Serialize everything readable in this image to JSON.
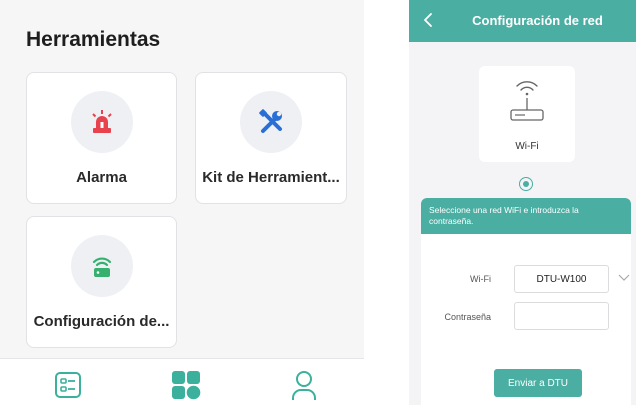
{
  "left": {
    "title": "Herramientas",
    "tools": [
      {
        "label": "Alarma",
        "icon": "alarm-light-icon",
        "color": "#e8424f"
      },
      {
        "label": "Kit de Herramient...",
        "icon": "tools-icon",
        "color": "#2a6fd6"
      },
      {
        "label": "Configuración de...",
        "icon": "router-wifi-icon",
        "color": "#35b06e"
      }
    ],
    "bottom_nav": [
      {
        "icon": "list-icon",
        "active": false
      },
      {
        "icon": "grid-icon",
        "active": true
      },
      {
        "icon": "user-icon",
        "active": false
      }
    ],
    "accent_color": "#3bb09c"
  },
  "right": {
    "header_title": "Configuración de red",
    "mode_label": "Wi-Fi",
    "hint": "Seleccione una red WiFi e introduzca la contraseña.",
    "wifi_label": "Wi-Fi",
    "wifi_value": "DTU-W100",
    "password_label": "Contraseña",
    "password_value": "",
    "send_button": "Enviar a DTU",
    "accent_color": "#4aaea2"
  }
}
